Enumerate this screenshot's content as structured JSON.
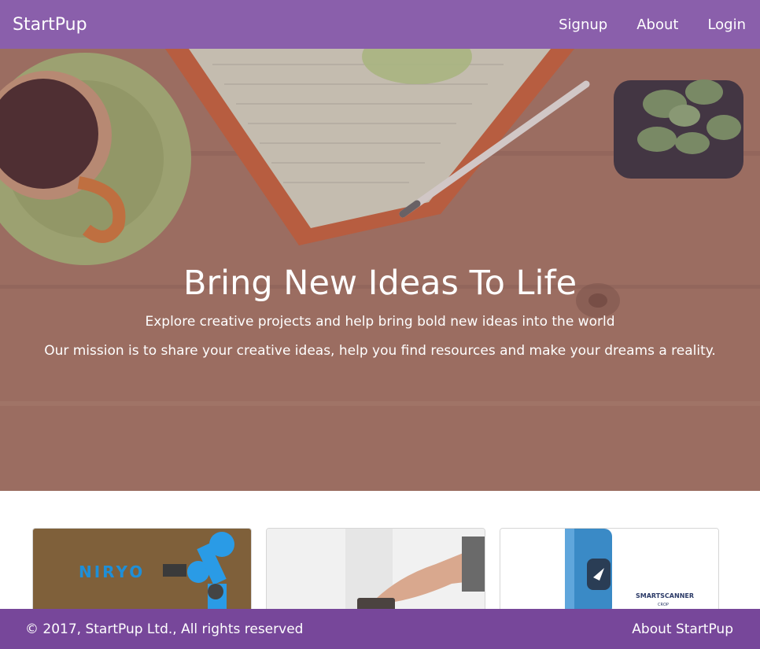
{
  "navbar": {
    "brand": "StartPup",
    "links": [
      "Signup",
      "About",
      "Login"
    ],
    "color": "#8a5fab"
  },
  "hero": {
    "title": "Bring New Ideas To Life",
    "subtitle": "Explore creative projects and help bring bold new ideas into the world",
    "mission": "Our mission is to share your creative ideas, help you find resources and make your dreams a reality."
  },
  "cards": [
    {
      "image": "robot-arm-photo",
      "logo_text": "NIRYO"
    },
    {
      "image": "hand-pressing-button-photo"
    },
    {
      "image": "smart-scanner-photo",
      "product_text": "SMARTSCANNER",
      "product_sub": "CROP"
    }
  ],
  "footer": {
    "copyright": "© 2017, StartPup Ltd., All rights reserved",
    "about_link": "About StartPup",
    "color": "#77479a"
  }
}
